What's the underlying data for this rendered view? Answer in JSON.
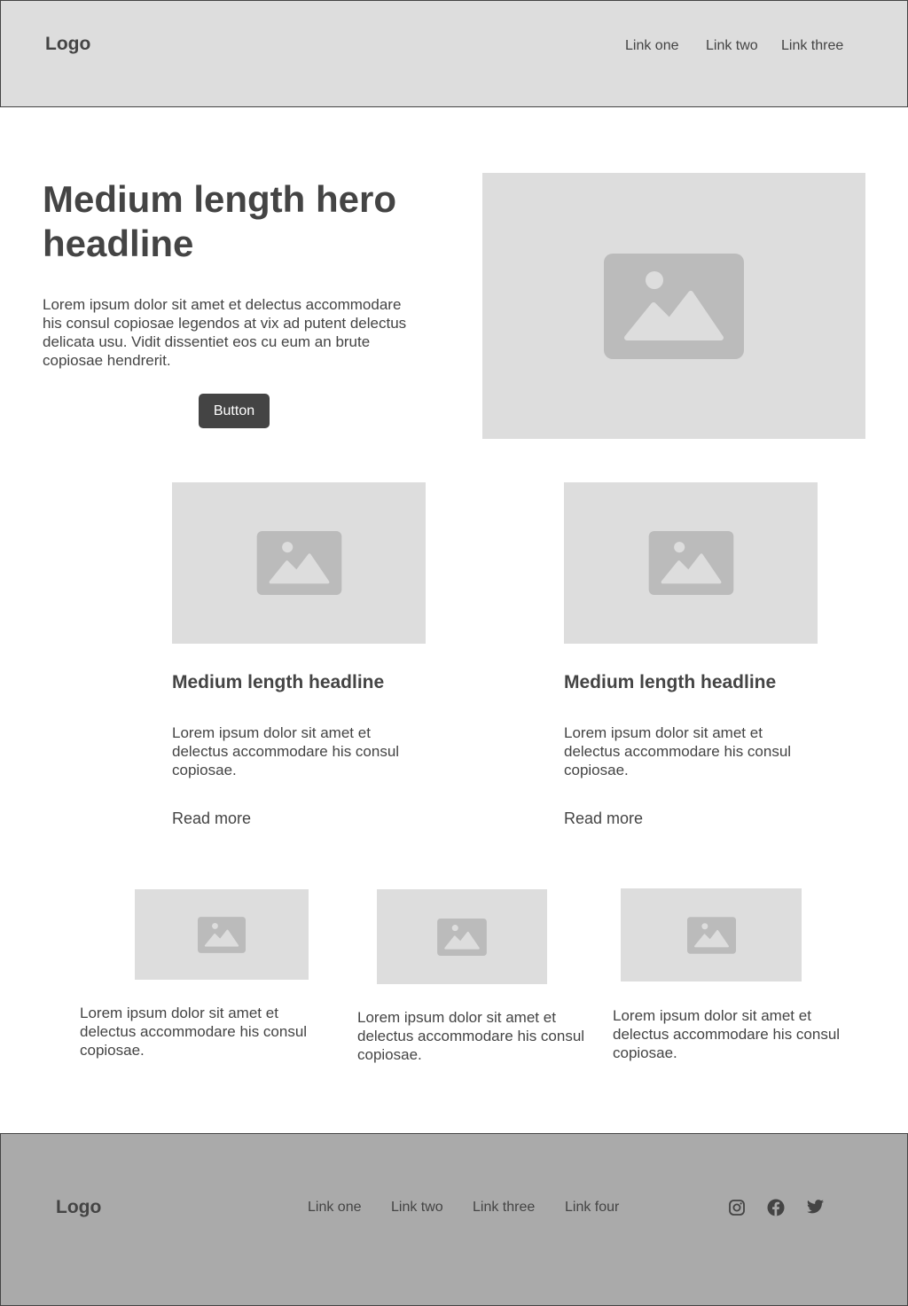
{
  "header": {
    "logo": "Logo",
    "links": [
      "Link one",
      "Link two",
      "Link three"
    ]
  },
  "hero": {
    "headline": "Medium length hero headline",
    "body": "Lorem ipsum dolor sit amet et delectus accommodare his consul copiosae legendos at vix ad putent delectus delicata usu. Vidit dissentiet eos cu eum an brute copiosae hendrerit.",
    "button_label": "Button",
    "image_icon": "image-icon"
  },
  "features": [
    {
      "headline": "Medium length headline",
      "body": "Lorem ipsum dolor sit amet et delectus accommodare his consul copiosae.",
      "link": "Read more",
      "image_icon": "image-icon"
    },
    {
      "headline": "Medium length headline",
      "body": "Lorem ipsum dolor sit amet et delectus accommodare his consul copiosae.",
      "link": "Read more",
      "image_icon": "image-icon"
    }
  ],
  "gallery": [
    {
      "body": "Lorem ipsum dolor sit amet et delectus accommodare his consul copiosae.",
      "image_icon": "image-icon"
    },
    {
      "body": "Lorem ipsum dolor sit amet et delectus accommodare his consul copiosae.",
      "image_icon": "image-icon"
    },
    {
      "body": "Lorem ipsum dolor sit amet et delectus accommodare his consul copiosae.",
      "image_icon": "image-icon"
    }
  ],
  "footer": {
    "logo": "Logo",
    "links": [
      "Link one",
      "Link two",
      "Link three",
      "Link four"
    ],
    "social_icons": [
      "instagram-icon",
      "facebook-icon",
      "twitter-icon"
    ]
  },
  "colors": {
    "text": "#444444",
    "header_bg": "#dddddd",
    "placeholder_bg": "#dddddd",
    "placeholder_icon": "#bbbbbb",
    "button_bg": "#444444",
    "footer_bg": "#aaaaaa"
  }
}
